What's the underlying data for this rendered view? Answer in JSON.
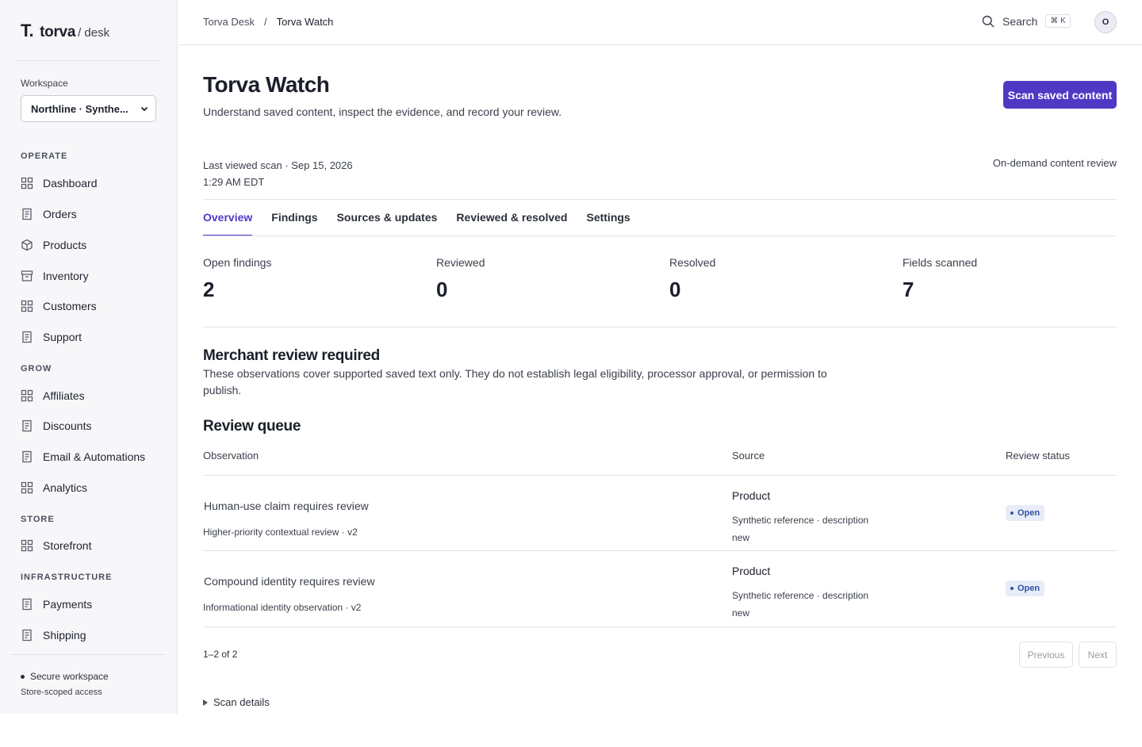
{
  "brand": {
    "mark": "T.",
    "name": "torva",
    "sub": "/ desk"
  },
  "workspace": {
    "label": "Workspace",
    "selected": "Northline · Synthe..."
  },
  "sidebar": {
    "sections": {
      "operate": "OPERATE",
      "grow": "GROW",
      "store": "STORE",
      "infrastructure": "INFRASTRUCTURE"
    },
    "items": {
      "dashboard": "Dashboard",
      "orders": "Orders",
      "products": "Products",
      "inventory": "Inventory",
      "customers": "Customers",
      "support": "Support",
      "affiliates": "Affiliates",
      "discounts": "Discounts",
      "email": "Email & Automations",
      "analytics": "Analytics",
      "storefront": "Storefront",
      "payments": "Payments",
      "shipping": "Shipping"
    },
    "footer": {
      "secure": "Secure workspace",
      "access": "Store-scoped access"
    }
  },
  "header": {
    "breadcrumb": [
      "Torva Desk",
      "/",
      "Torva Watch"
    ],
    "search_label": "Search",
    "search_shortcut": "⌘ K",
    "avatar_initial": "O"
  },
  "page": {
    "title": "Torva Watch",
    "subtitle": "Understand saved content, inspect the evidence, and record your review.",
    "primary_button": "Scan saved content",
    "last_scan_line1": "Last viewed scan · Sep 15, 2026",
    "last_scan_line2": "1:29 AM EDT",
    "mode": "On-demand content review"
  },
  "tabs": [
    "Overview",
    "Findings",
    "Sources & updates",
    "Reviewed & resolved",
    "Settings"
  ],
  "stats": [
    {
      "label": "Open findings",
      "value": "2"
    },
    {
      "label": "Reviewed",
      "value": "0"
    },
    {
      "label": "Resolved",
      "value": "0"
    },
    {
      "label": "Fields scanned",
      "value": "7"
    }
  ],
  "notice": {
    "title": "Merchant review required",
    "text": "These observations cover supported saved text only. They do not establish legal eligibility, processor approval, or permission to publish."
  },
  "queue": {
    "title": "Review queue",
    "columns": [
      "Observation",
      "Source",
      "Review status"
    ],
    "rows": [
      {
        "observation": "Human-use claim requires review",
        "detail": "Higher-priority contextual review · v2",
        "source": "Product",
        "source_ref": "Synthetic reference · description",
        "source_state": "new",
        "status": "Open"
      },
      {
        "observation": "Compound identity requires review",
        "detail": "Informational identity observation · v2",
        "source": "Product",
        "source_ref": "Synthetic reference · description",
        "source_state": "new",
        "status": "Open"
      }
    ],
    "count": "1–2 of 2",
    "previous": "Previous",
    "next": "Next"
  },
  "scan_details": "Scan details",
  "colors": {
    "accent": "#5138c4",
    "badge_bg": "#e7ecf8",
    "badge_fg": "#3453a8"
  }
}
